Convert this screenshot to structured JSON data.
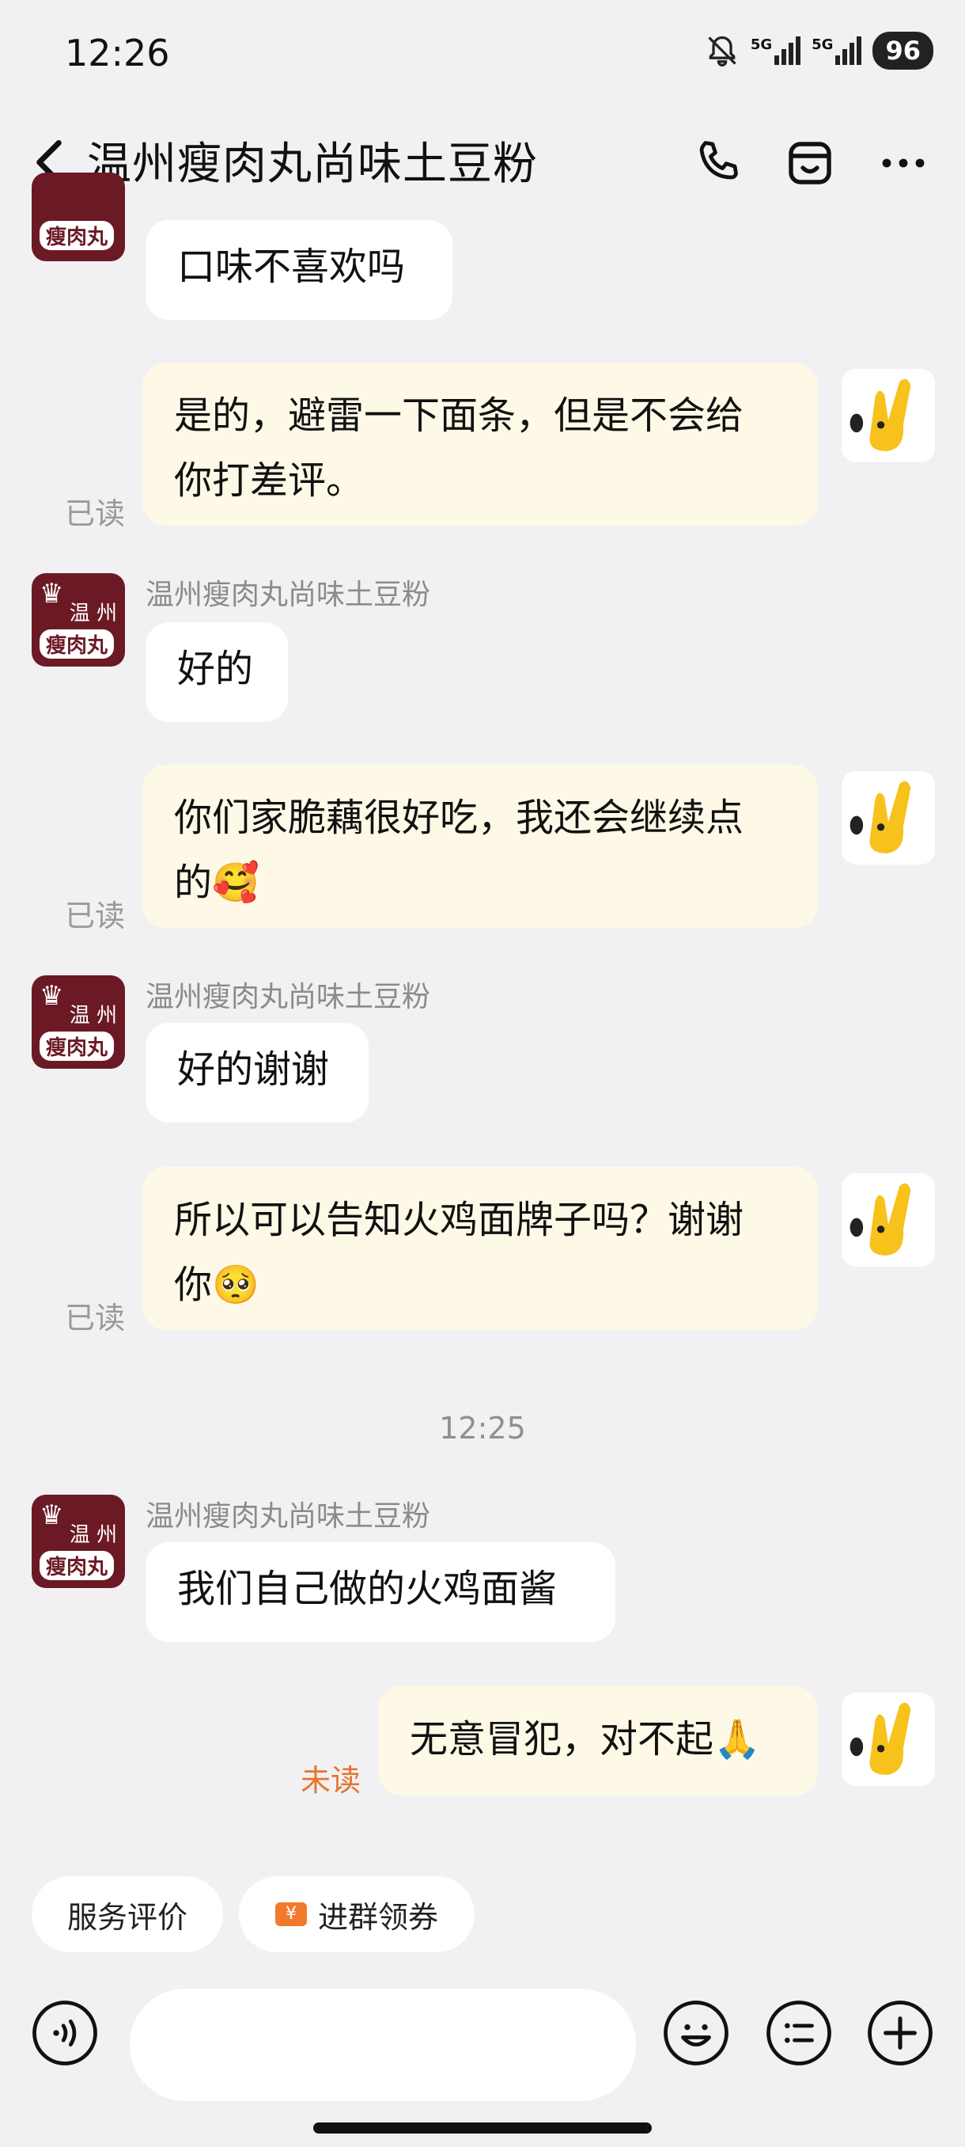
{
  "status_bar": {
    "time": "12:26",
    "battery": "96",
    "signal_1": "5G",
    "signal_2": "5G"
  },
  "header": {
    "title": "温州瘦肉丸尚味土豆粉"
  },
  "shop_avatar": {
    "line1": "温 州",
    "line2": "瘦肉丸"
  },
  "messages": [
    {
      "side": "in",
      "sender": "",
      "text": "口味不喜欢吗"
    },
    {
      "side": "out",
      "status": "已读",
      "line1": "是的，避雷一下面条，但是不会给",
      "line2": "你打差评。"
    },
    {
      "side": "in",
      "sender": "温州瘦肉丸尚味土豆粉",
      "text": "好的"
    },
    {
      "side": "out",
      "status": "已读",
      "line1": "你们家脆藕很好吃，我还会继续点",
      "line2": "的🥰"
    },
    {
      "side": "in",
      "sender": "温州瘦肉丸尚味土豆粉",
      "text": "好的谢谢"
    },
    {
      "side": "out",
      "status": "已读",
      "line1": "所以可以告知火鸡面牌子吗？谢谢",
      "line2": "你🥺"
    },
    {
      "side": "in",
      "sender": "温州瘦肉丸尚味土豆粉",
      "text": "我们自己做的火鸡面酱"
    },
    {
      "side": "out",
      "status": "未读",
      "text": "无意冒犯，对不起🙏"
    }
  ],
  "timestamp": "12:25",
  "chips": {
    "service_rating": "服务评价",
    "join_group": "进群领券",
    "coupon_symbol": "¥"
  },
  "input": {
    "placeholder": ""
  },
  "colors": {
    "background": "#f1f1f3",
    "incoming_bubble": "#ffffff",
    "outgoing_bubble": "#fdf9e6",
    "unread": "#e8742c",
    "shop_avatar": "#6b1a25"
  }
}
